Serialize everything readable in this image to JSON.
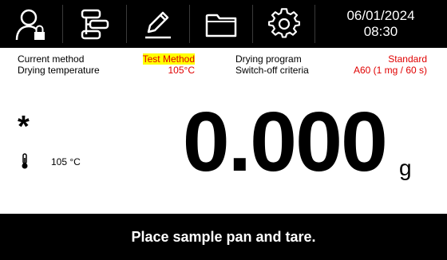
{
  "toolbar": {
    "buttons": [
      {
        "icon": "user-lock-icon"
      },
      {
        "icon": "method-list-icon"
      },
      {
        "icon": "pencil-edit-icon"
      },
      {
        "icon": "folder-icon"
      },
      {
        "icon": "gear-icon"
      }
    ],
    "date": "06/01/2024",
    "time": "08:30"
  },
  "info": {
    "current_method_label": "Current method",
    "current_method_value": "Test Method",
    "drying_temperature_label": "Drying temperature",
    "drying_temperature_value": "105°C",
    "drying_program_label": "Drying program",
    "drying_program_value": "Standard",
    "switch_off_label": "Switch-off criteria",
    "switch_off_value": "A60 (1 mg / 60 s)"
  },
  "display": {
    "stability_symbol": "*",
    "temperature": "105 °C",
    "weight": "0.000",
    "unit": "g"
  },
  "status_message": "Place sample pan and tare.",
  "colors": {
    "background": "#ffffff",
    "bar": "#000000",
    "accent_red": "#e00000",
    "highlight": "#ffff00"
  }
}
